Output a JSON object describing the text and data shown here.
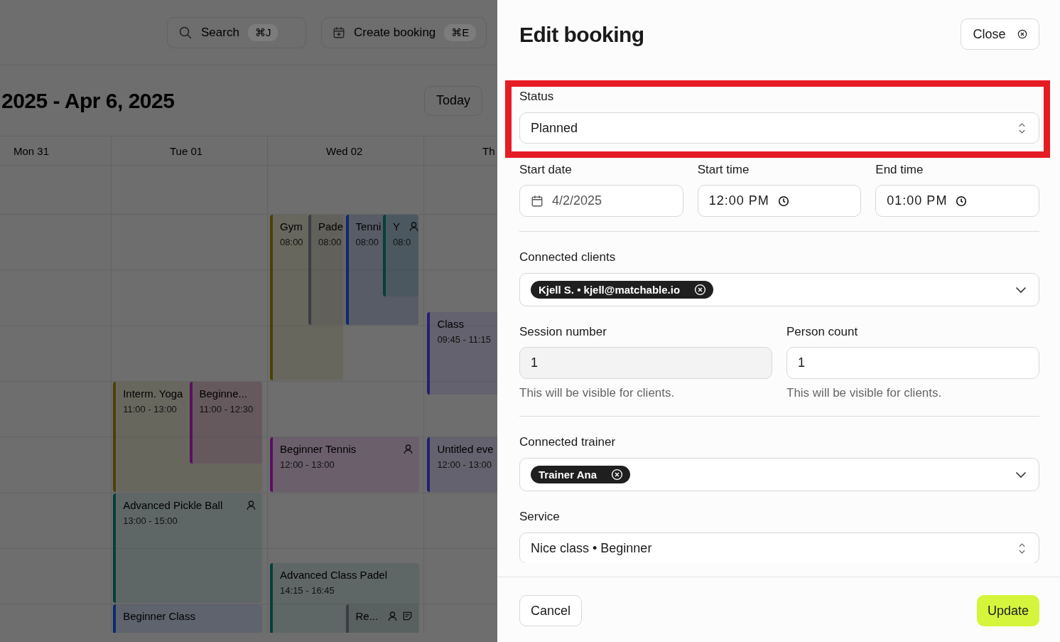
{
  "topbar": {
    "search": {
      "label": "Search",
      "shortcut": "⌘J"
    },
    "create": {
      "label": "Create booking",
      "shortcut": "⌘E"
    }
  },
  "calendar": {
    "range": "2025 - Apr 6, 2025",
    "today_label": "Today",
    "days": [
      {
        "label": "Mon 31"
      },
      {
        "label": "Tue 01",
        "events": [
          {
            "title": "Interm. Yoga",
            "time": "11:00 - 13:00",
            "color": "#4a4105",
            "person_icon": false,
            "note_icon": false
          },
          {
            "title": "Beginne...",
            "time": "11:00 - 12:30",
            "color": "#5a0f60",
            "person_icon": false,
            "note_icon": false
          },
          {
            "title": "Advanced Pickle Ball",
            "time": "13:00 - 15:00",
            "color": "#06403b",
            "person_icon": true,
            "note_icon": false
          },
          {
            "title": "Beginner Class",
            "color": "#0d2a6e",
            "person_icon": false,
            "note_icon": false
          }
        ]
      },
      {
        "label": "Wed 02",
        "events": [
          {
            "title": "Gym",
            "time": "08:00",
            "color": "#4a4105",
            "person_icon": false,
            "note_icon": false
          },
          {
            "title": "Pade",
            "time": "08:00",
            "color": "#3a3d44",
            "person_icon": false,
            "note_icon": false
          },
          {
            "title": "Tenni",
            "time": "08:00",
            "color": "#0d2a6e",
            "person_icon": false,
            "note_icon": false
          },
          {
            "title": "Y",
            "time": "08:0",
            "color": "#06403b",
            "person_icon": true,
            "note_icon": false
          },
          {
            "title": "Beginner Tennis",
            "time": "12:00 - 13:00",
            "color": "#5a0f60",
            "person_icon": true,
            "note_icon": false
          },
          {
            "title": "Advanced Class Padel",
            "time": "14:15 - 16:45",
            "color": "#06403b",
            "person_icon": false,
            "note_icon": false
          },
          {
            "title": "Re...",
            "color": "#3a3d44",
            "person_icon": true,
            "note_icon": true
          }
        ]
      },
      {
        "label": "Th",
        "events": [
          {
            "title": "Class",
            "time": "09:45 - 11:15",
            "color": "#252070",
            "person_icon": false,
            "note_icon": false
          },
          {
            "title": "Untitled eve",
            "time": "12:00 - 13:00",
            "color": "#252070",
            "person_icon": false,
            "note_icon": false
          }
        ]
      }
    ]
  },
  "panel": {
    "title": "Edit booking",
    "close_label": "Close",
    "status": {
      "label": "Status",
      "value": "Planned",
      "highlighted": true
    },
    "start_date": {
      "label": "Start date",
      "value": "4/2/2025"
    },
    "start_time": {
      "label": "Start time",
      "value": "12:00 PM"
    },
    "end_time": {
      "label": "End time",
      "value": "01:00 PM"
    },
    "connected_clients": {
      "label": "Connected clients",
      "chips": [
        "Kjell S. • kjell@matchable.io"
      ]
    },
    "session_number": {
      "label": "Session number",
      "value": "1",
      "hint": "This will be visible for clients.",
      "disabled": true
    },
    "person_count": {
      "label": "Person count",
      "value": "1",
      "hint": "This will be visible for clients.",
      "disabled": false
    },
    "connected_trainer": {
      "label": "Connected trainer",
      "chips": [
        "Trainer Ana"
      ]
    },
    "service": {
      "label": "Service",
      "value": "Nice class • Beginner"
    },
    "cancel_label": "Cancel",
    "update_label": "Update"
  }
}
